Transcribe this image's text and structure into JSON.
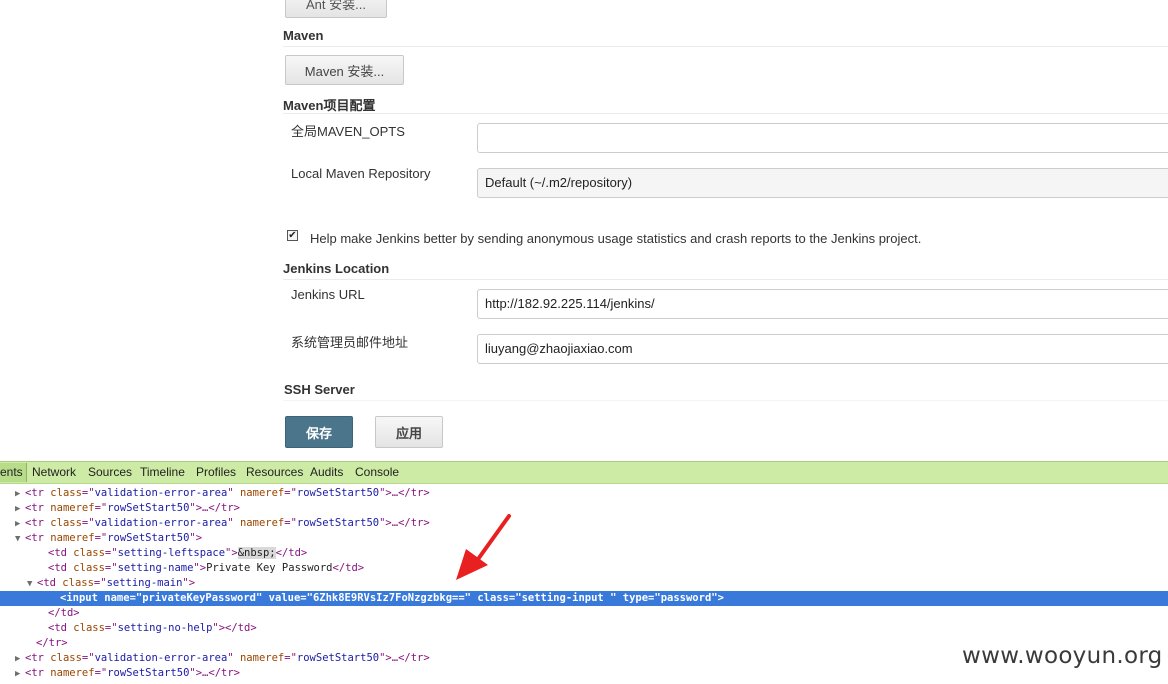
{
  "jenkins": {
    "ant_button": "Ant 安装...",
    "maven_header": "Maven",
    "maven_button": "Maven 安装...",
    "maven_config_header": "Maven项目配置",
    "maven_opts_label": "全局MAVEN_OPTS",
    "maven_opts_value": "",
    "local_repo_label": "Local Maven Repository",
    "local_repo_value": "Default (~/.m2/repository)",
    "usage_stats_checked": true,
    "usage_stats_check_glyph": "✔",
    "usage_stats_label": "Help make Jenkins better by sending anonymous usage statistics and crash reports to the Jenkins project.",
    "location_header": "Jenkins Location",
    "url_label": "Jenkins URL",
    "url_value": "http://182.92.225.114/jenkins/",
    "email_label": "系统管理员邮件地址",
    "email_value": "liuyang@zhaojiaxiao.com",
    "ssh_header": "SSH Server",
    "save_button": "保存",
    "apply_button": "应用",
    "primary_color": "#4b758b"
  },
  "devtools": {
    "tabs": [
      "ents",
      "Network",
      "Sources",
      "Timeline",
      "Profiles",
      "Resources",
      "Audits",
      "Console"
    ],
    "toolbar_color": "#cdeba4",
    "selection_color": "#3879d9",
    "dom_lines": [
      {
        "tri": "▶",
        "tag_open": "<tr ",
        "attrs": [
          [
            "class",
            "validation-error-area"
          ],
          [
            "nameref",
            "rowSetStart50"
          ]
        ],
        "tail": ">…</tr>"
      },
      {
        "tri": "▶",
        "tag_open": "<tr ",
        "attrs": [
          [
            "nameref",
            "rowSetStart50"
          ]
        ],
        "tail": ">…</tr>"
      },
      {
        "tri": "▶",
        "tag_open": "<tr ",
        "attrs": [
          [
            "class",
            "validation-error-area"
          ],
          [
            "nameref",
            "rowSetStart50"
          ]
        ],
        "tail": ">…</tr>"
      },
      {
        "tri": "▼",
        "tag_open": "<tr ",
        "attrs": [
          [
            "nameref",
            "rowSetStart50"
          ]
        ],
        "tail": ">"
      },
      {
        "tri": "",
        "tag_open": "<td ",
        "attrs": [
          [
            "class",
            "setting-leftspace"
          ]
        ],
        "tail": ">",
        "entity": "&nbsp;",
        "close": "</td>"
      },
      {
        "tri": "",
        "tag_open": "<td ",
        "attrs": [
          [
            "class",
            "setting-name"
          ]
        ],
        "tail": ">",
        "text": "Private Key Password",
        "close": "</td>"
      },
      {
        "tri": "▼",
        "tag_open": "<td ",
        "attrs": [
          [
            "class",
            "setting-main"
          ]
        ],
        "tail": ">"
      },
      {
        "tri": "",
        "tag_open": "<input ",
        "attrs": [
          [
            "name",
            "privateKeyPassword"
          ],
          [
            "value",
            "6Zhk8E9RVsIz7FoNzgzbkg=="
          ],
          [
            "class",
            "setting-input "
          ],
          [
            "type",
            "password"
          ]
        ],
        "tail": ">"
      },
      {
        "tri": "",
        "tag_open": "</td>",
        "attrs": [],
        "tail": ""
      },
      {
        "tri": "",
        "tag_open": "<td ",
        "attrs": [
          [
            "class",
            "setting-no-help"
          ]
        ],
        "tail": "></td>"
      },
      {
        "tri": "",
        "tag_open": "</tr>",
        "attrs": [],
        "tail": ""
      },
      {
        "tri": "▶",
        "tag_open": "<tr ",
        "attrs": [
          [
            "class",
            "validation-error-area"
          ],
          [
            "nameref",
            "rowSetStart50"
          ]
        ],
        "tail": ">…</tr>"
      },
      {
        "tri": "▶",
        "tag_open": "<tr ",
        "attrs": [
          [
            "nameref",
            "rowSetStart50"
          ]
        ],
        "tail": ">…</tr>"
      }
    ]
  },
  "watermark": "www.wooyun.org"
}
